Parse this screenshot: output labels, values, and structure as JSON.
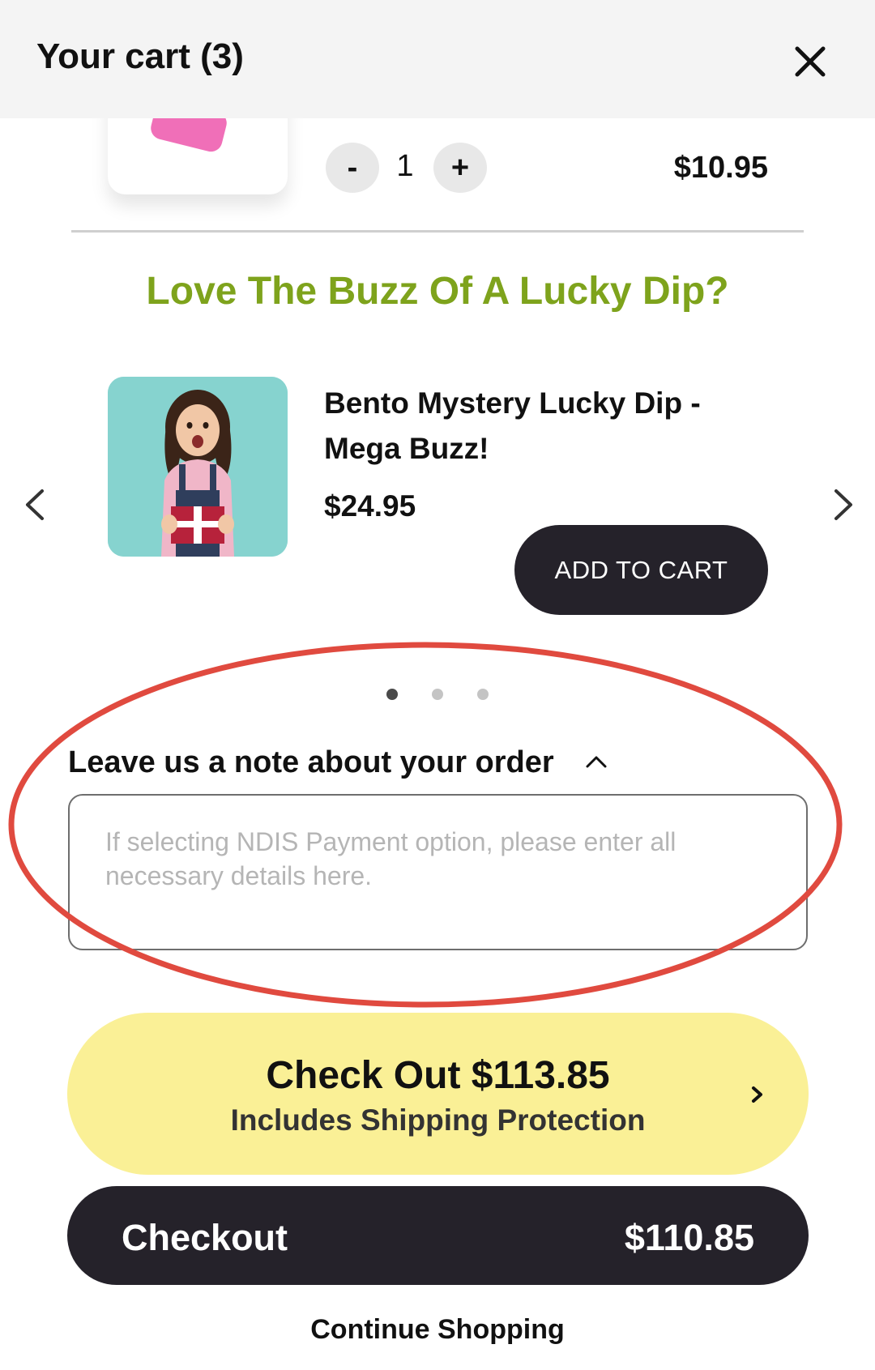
{
  "header": {
    "title": "Your cart (3)",
    "close_icon": "close-icon"
  },
  "cart_item": {
    "minus_label": "-",
    "quantity": "1",
    "plus_label": "+",
    "price": "$10.95"
  },
  "upsell": {
    "title": "Love The Buzz Of A Lucky Dip?",
    "product": {
      "name": "Bento Mystery Lucky Dip - Mega Buzz!",
      "price": "$24.95",
      "add_label": "ADD TO CART"
    },
    "prev_icon": "chevron-left-icon",
    "next_icon": "chevron-right-icon",
    "dots_total": 3,
    "dots_active": 1
  },
  "note": {
    "label": "Leave us a note about your order",
    "toggle_icon": "chevron-up-icon",
    "placeholder": "If selecting NDIS Payment option, please enter all necessary details here.",
    "value": ""
  },
  "checkout_protected": {
    "title": "Check Out $113.85",
    "subtitle": "Includes Shipping Protection"
  },
  "checkout": {
    "label": "Checkout",
    "amount": "$110.85"
  },
  "continue_label": "Continue Shopping",
  "colors": {
    "upsell_title": "#7ea31c",
    "dark_button": "#25222a",
    "yellow_button": "#faf096",
    "annotation": "#e04a3f",
    "header_bg": "#f4f4f4"
  }
}
